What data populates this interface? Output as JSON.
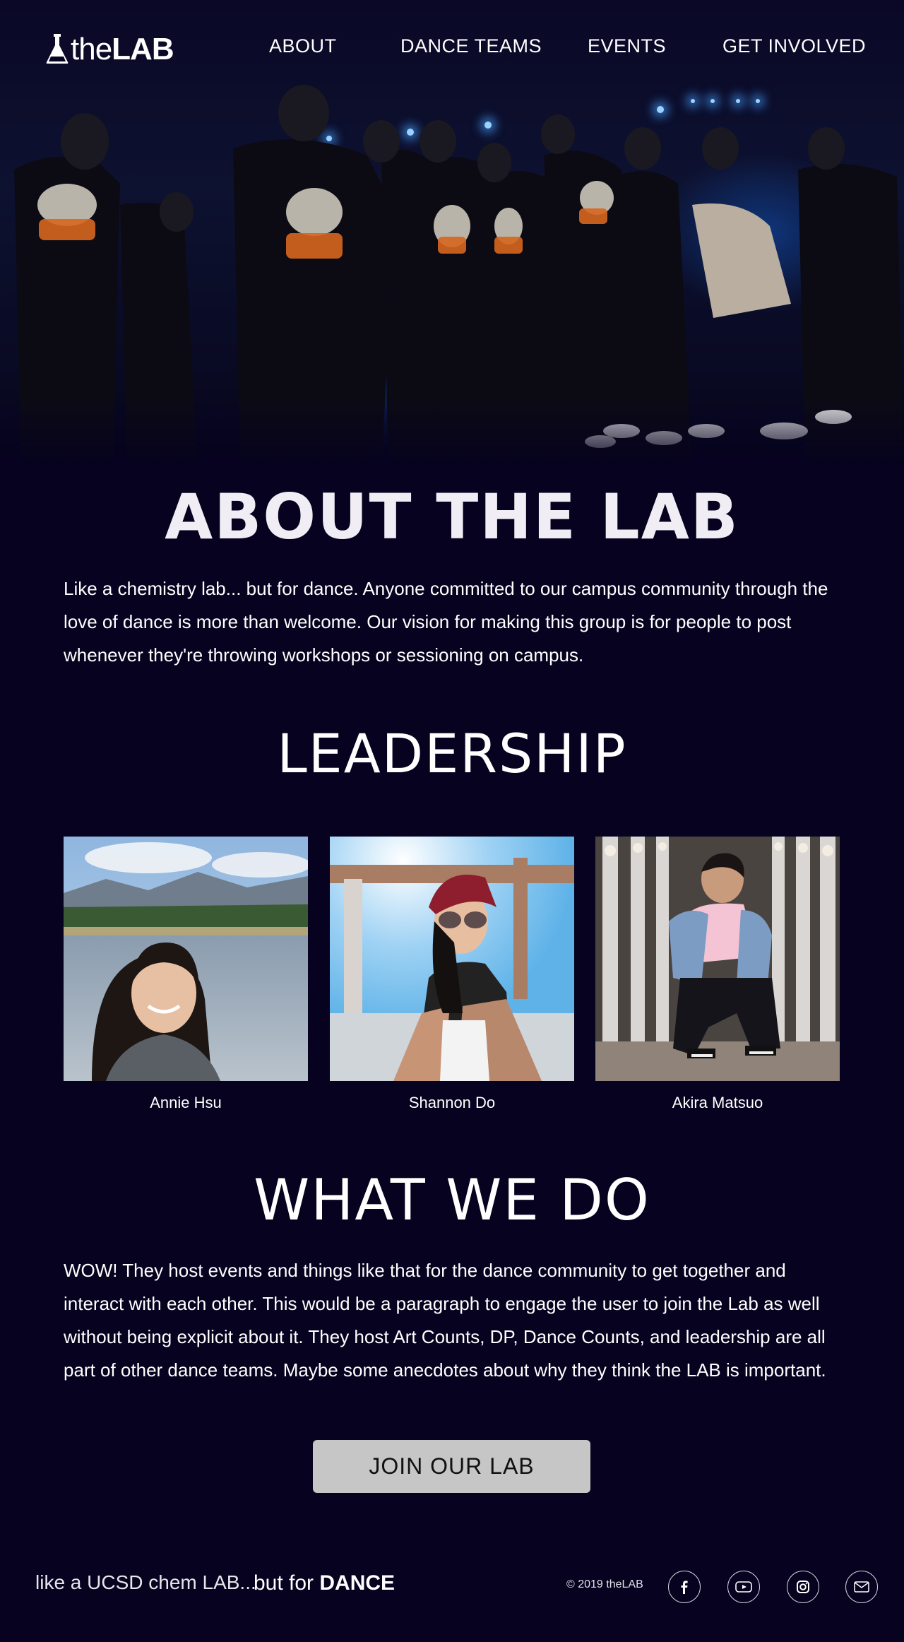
{
  "brand": {
    "logo_prefix": "the",
    "logo_main": "LAB"
  },
  "nav": {
    "items": [
      {
        "label": "ABOUT"
      },
      {
        "label": "DANCE TEAMS"
      },
      {
        "label": "EVENTS"
      },
      {
        "label": "GET INVOLVED"
      }
    ]
  },
  "about": {
    "title": "ABOUT THE LAB",
    "body": "Like a chemistry lab... but for dance. Anyone committed to our campus community through the love of dance is more than welcome. Our vision for making this group is for people to post whenever they're throwing workshops or sessioning on campus."
  },
  "leadership": {
    "title": "LEADERSHIP",
    "members": [
      {
        "name": "Annie Hsu"
      },
      {
        "name": "Shannon Do"
      },
      {
        "name": "Akira Matsuo"
      }
    ]
  },
  "what_we_do": {
    "title": "WHAT WE DO",
    "body": "WOW! They host events and things like that for the dance community to get together and interact with each other. This would be a paragraph to engage the user to join the Lab as well without being explicit about it. They host Art Counts, DP, Dance Counts, and leadership are all part of other dance teams. Maybe some anecdotes about why they think the LAB is important."
  },
  "cta": {
    "label": "JOIN OUR LAB"
  },
  "footer": {
    "tagline_left": "like a UCSD chem LAB...",
    "tagline_right_prefix": "but for ",
    "tagline_right_bold": "DANCE",
    "copyright": "© 2019 theLAB",
    "social_icons": [
      "facebook-icon",
      "youtube-icon",
      "instagram-icon",
      "mail-icon"
    ]
  },
  "colors": {
    "background": "#06021f",
    "button": "#c6c6c6",
    "stage_light": "#1f6fe0"
  }
}
